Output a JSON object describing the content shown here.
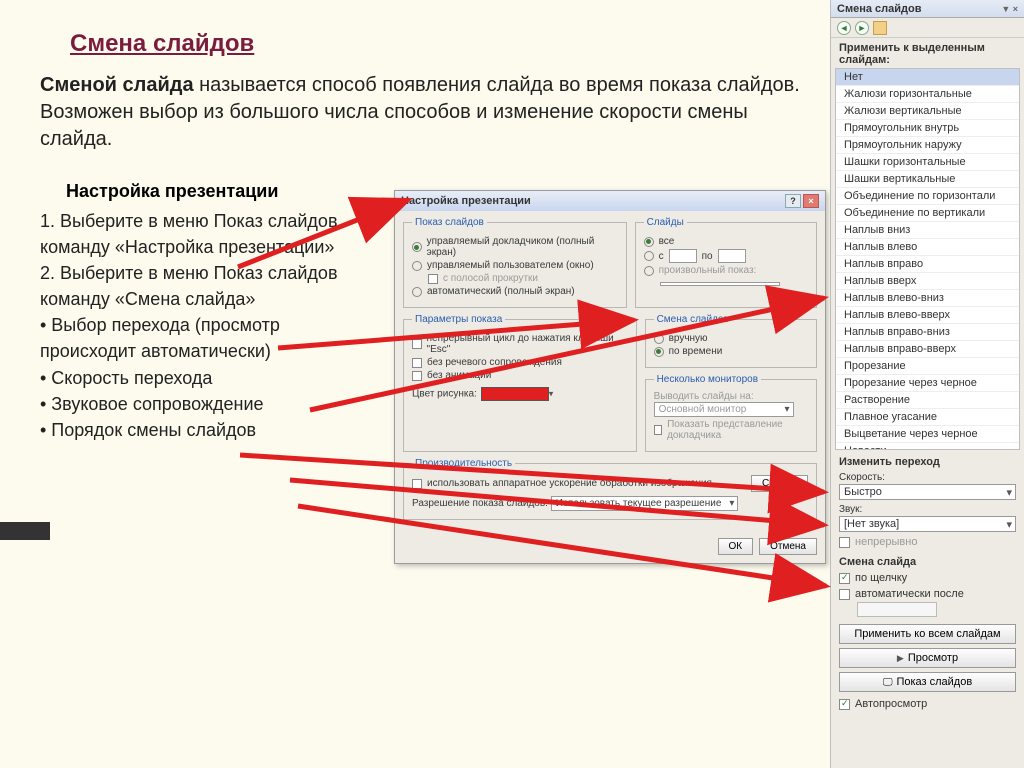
{
  "slide": {
    "title": "Смена слайдов",
    "lead_bold": "Сменой слайда",
    "lead_rest": " называется способ появления слайда во время показа слайдов. Возможен выбор из большого числа способов и изменение скорости смены слайда.",
    "sub": "Настройка презентации",
    "step1": "1. Выберите в меню Показ слайдов команду «Настройка презентации»",
    "step2": "2. Выберите в меню Показ слайдов команду «Смена слайда»",
    "b1": "• Выбор перехода (просмотр происходит автоматически)",
    "b2": "• Скорость перехода",
    "b3": "• Звуковое сопровождение",
    "b4": "• Порядок смены слайдов"
  },
  "dialog": {
    "title": "Настройка презентации",
    "fs_show": "Показ слайдов",
    "r_show1": "управляемый докладчиком (полный экран)",
    "r_show2": "управляемый пользователем (окно)",
    "c_scroll": "с полосой прокрутки",
    "r_show3": "автоматический (полный экран)",
    "fs_slides": "Слайды",
    "r_all": "все",
    "r_from": "с",
    "r_to": "по",
    "r_custom": "произвольный показ:",
    "fs_params": "Параметры показа",
    "c_loop": "непрерывный цикл до нажатия клавиши \"Esc\"",
    "c_novoice": "без речевого сопровождения",
    "c_noanim": "без анимации",
    "l_pencol": "Цвет рисунка:",
    "fs_advance": "Смена слайдов",
    "r_manual": "вручную",
    "r_timed": "по времени",
    "fs_mon": "Несколько мониторов",
    "l_monout": "Выводить слайды на:",
    "sel_mon": "Основной монитор",
    "c_presview": "Показать представление докладчика",
    "fs_perf": "Производительность",
    "c_hw": "использовать аппаратное ускорение обработки изображения",
    "btn_tips": "Советы",
    "l_res": "Разрешение показа слайдов:",
    "sel_res": "Использовать текущее разрешение",
    "btn_ok": "ОК",
    "btn_cancel": "Отмена"
  },
  "pane": {
    "title": "Смена слайдов",
    "apply_label": "Применить к выделенным слайдам:",
    "items": [
      "Нет",
      "Жалюзи горизонтальные",
      "Жалюзи вертикальные",
      "Прямоугольник внутрь",
      "Прямоугольник наружу",
      "Шашки горизонтальные",
      "Шашки вертикальные",
      "Объединение по горизонтали",
      "Объединение по вертикали",
      "Наплыв вниз",
      "Наплыв влево",
      "Наплыв вправо",
      "Наплыв вверх",
      "Наплыв влево-вниз",
      "Наплыв влево-вверх",
      "Наплыв вправо-вниз",
      "Наплыв вправо-вверх",
      "Прорезание",
      "Прорезание через черное",
      "Растворение",
      "Плавное угасание",
      "Выцветание через черное",
      "Новости"
    ],
    "sect_mod": "Изменить переход",
    "l_speed": "Скорость:",
    "v_speed": "Быстро",
    "l_sound": "Звук:",
    "v_sound": "[Нет звука]",
    "c_cont": "непрерывно",
    "sect_adv": "Смена слайда",
    "c_click": "по щелчку",
    "c_auto": "автоматически после",
    "btn_applyall": "Применить ко всем слайдам",
    "btn_preview": "Просмотр",
    "btn_show": "Показ слайдов",
    "c_autoprev": "Автопросмотр"
  }
}
